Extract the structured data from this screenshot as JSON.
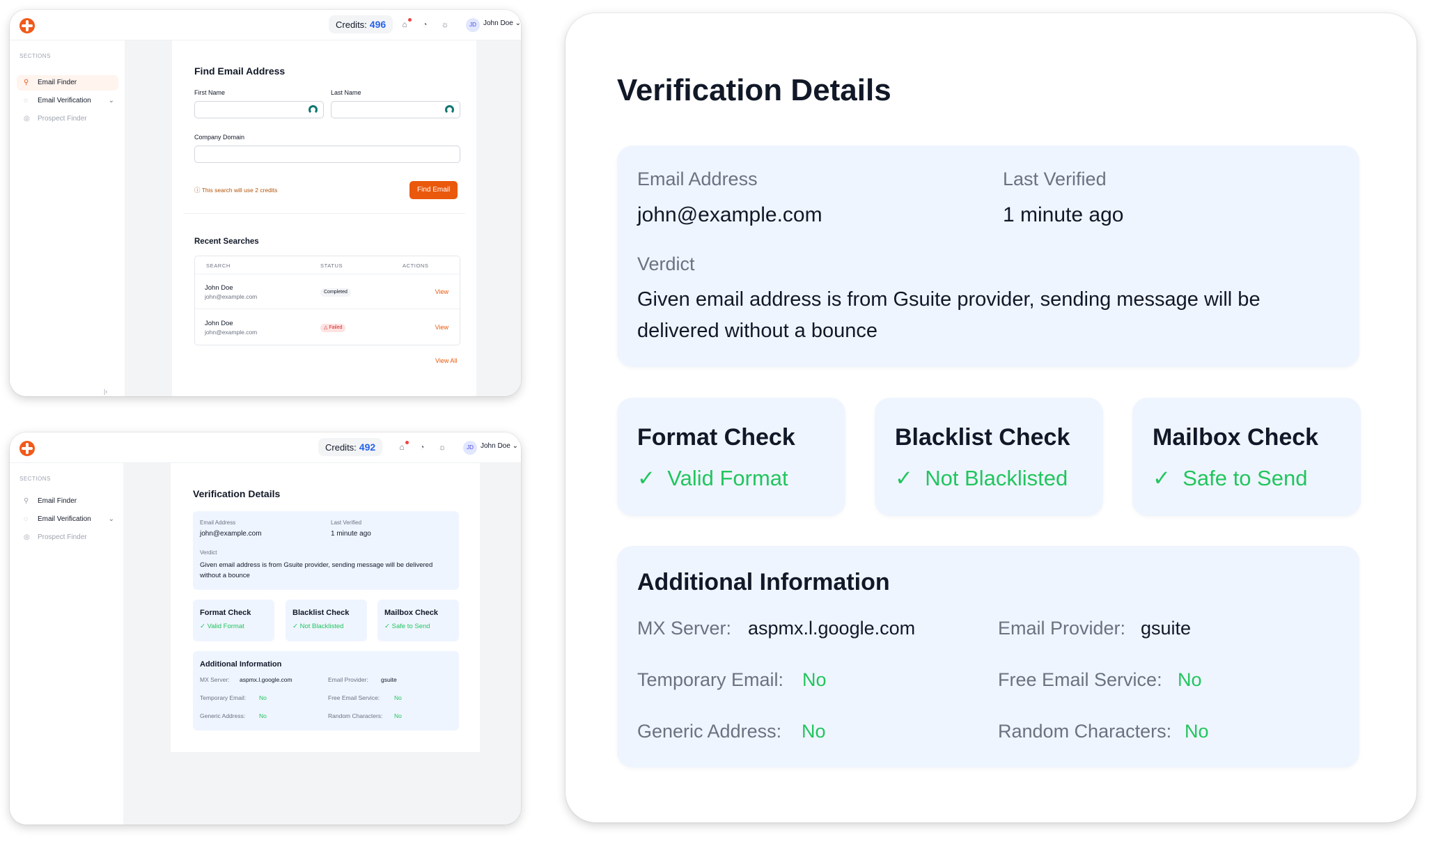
{
  "finder": {
    "credits_label": "Credits:",
    "credits_value": "496",
    "user_initials": "JD",
    "user_name": "John Doe",
    "sections_label": "SECTIONS",
    "nav": [
      "Email Finder",
      "Email Verification",
      "Prospect Finder"
    ],
    "title": "Find Email Address",
    "first_name_label": "First Name",
    "last_name_label": "Last Name",
    "domain_label": "Company Domain",
    "credit_note": "This search will use 2 credits",
    "find_button": "Find Email",
    "recent_title": "Recent Searches",
    "columns": [
      "SEARCH",
      "STATUS",
      "ACTIONS"
    ],
    "rows": [
      {
        "name": "John Doe",
        "email": "john@example.com",
        "status": "Completed",
        "action": "View"
      },
      {
        "name": "John Doe",
        "email": "john@example.com",
        "status": "Failed",
        "action": "View"
      }
    ],
    "view_all": "View All"
  },
  "verify_small": {
    "credits_label": "Credits:",
    "credits_value": "492",
    "user_initials": "JD",
    "user_name": "John Doe",
    "sections_label": "SECTIONS",
    "nav": [
      "Email Finder",
      "Email Verification",
      "Prospect Finder"
    ]
  },
  "details": {
    "title": "Verification Details",
    "email_label": "Email Address",
    "email_value": "john@example.com",
    "last_verified_label": "Last Verified",
    "last_verified_value": "1 minute ago",
    "verdict_label": "Verdict",
    "verdict_text": "Given email address is from Gsuite provider, sending message will be delivered without a bounce",
    "checks": [
      {
        "title": "Format Check",
        "value": "Valid Format"
      },
      {
        "title": "Blacklist Check",
        "value": "Not Blacklisted"
      },
      {
        "title": "Mailbox Check",
        "value": "Safe to Send"
      }
    ],
    "additional_title": "Additional Information",
    "mx_label": "MX Server:",
    "mx_value": "aspmx.l.google.com",
    "provider_label": "Email Provider:",
    "provider_value": "gsuite",
    "temp_label": "Temporary Email:",
    "temp_value": "No",
    "free_label": "Free Email Service:",
    "free_value": "No",
    "generic_label": "Generic Address:",
    "generic_value": "No",
    "random_label": "Random Characters:",
    "random_value": "No"
  },
  "colors": {
    "accent": "#ea580c",
    "link": "#2563eb",
    "success": "#22c55e",
    "panel": "#eff5ff"
  }
}
